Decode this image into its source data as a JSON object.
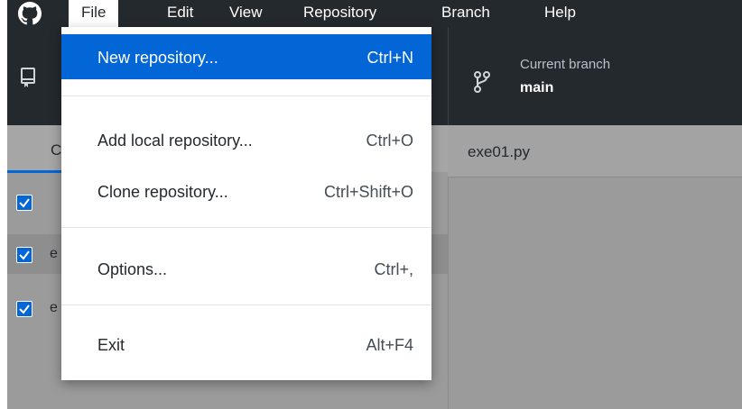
{
  "menubar": {
    "items": [
      "File",
      "Edit",
      "View",
      "Repository",
      "Branch",
      "Help"
    ]
  },
  "toolbar": {
    "branch": {
      "caption": "Current branch",
      "name": "main"
    }
  },
  "left_panel": {
    "tab_changes_partial": "C",
    "rows": [
      {
        "letter": "",
        "checked": true
      },
      {
        "letter": "e",
        "checked": true
      },
      {
        "letter": "e",
        "checked": true
      }
    ]
  },
  "right_panel": {
    "file_name": "exe01.py"
  },
  "file_menu": {
    "items": [
      {
        "label": "New repository...",
        "shortcut": "Ctrl+N"
      },
      {
        "label": "Add local repository...",
        "shortcut": "Ctrl+O"
      },
      {
        "label": "Clone repository...",
        "shortcut": "Ctrl+Shift+O"
      },
      {
        "label": "Options...",
        "shortcut": "Ctrl+,"
      },
      {
        "label": "Exit",
        "shortcut": "Alt+F4"
      }
    ]
  },
  "colors": {
    "chrome": "#24292e",
    "accent": "#0366d6",
    "overlay": "#9b9b9b"
  }
}
